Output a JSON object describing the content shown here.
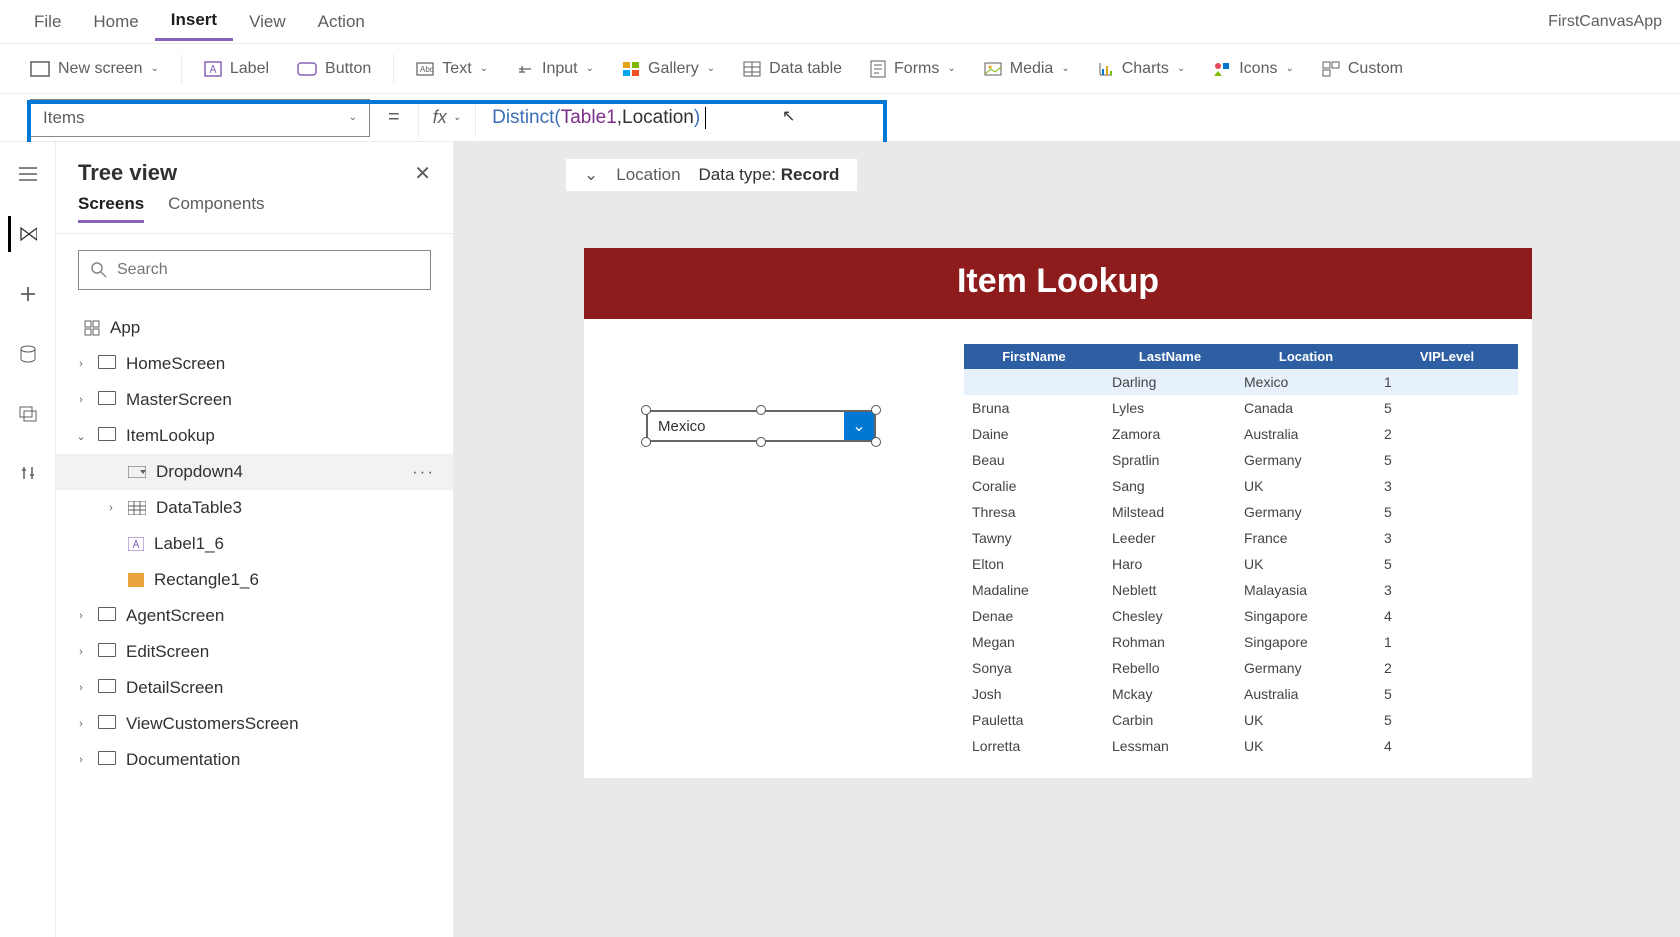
{
  "app_name": "FirstCanvasApp",
  "menu": [
    "File",
    "Home",
    "Insert",
    "View",
    "Action"
  ],
  "menu_active": "Insert",
  "ribbon": {
    "new_screen": "New screen",
    "label": "Label",
    "button": "Button",
    "text": "Text",
    "input": "Input",
    "gallery": "Gallery",
    "data_table": "Data table",
    "forms": "Forms",
    "media": "Media",
    "charts": "Charts",
    "icons": "Icons",
    "custom": "Custom"
  },
  "formula": {
    "property": "Items",
    "tokens": {
      "fn": "Distinct",
      "open": "(",
      "tbl": "Table1",
      "comma": ", ",
      "fld": "Location",
      "close": ")"
    }
  },
  "intelli": {
    "chev": "⌄",
    "field": "Location",
    "dt_label": "Data type:",
    "dt_value": "Record"
  },
  "tree": {
    "title": "Tree view",
    "tabs": [
      "Screens",
      "Components"
    ],
    "active_tab": "Screens",
    "search_placeholder": "Search",
    "app": "App",
    "nodes": [
      {
        "label": "HomeScreen",
        "depth": 0,
        "chev": "›",
        "icon": "screen"
      },
      {
        "label": "MasterScreen",
        "depth": 0,
        "chev": "›",
        "icon": "screen"
      },
      {
        "label": "ItemLookup",
        "depth": 0,
        "chev": "⌄",
        "icon": "screen"
      },
      {
        "label": "Dropdown4",
        "depth": 1,
        "chev": "",
        "icon": "dd",
        "selected": true,
        "more": "···"
      },
      {
        "label": "DataTable3",
        "depth": 1,
        "chev": "›",
        "icon": "table"
      },
      {
        "label": "Label1_6",
        "depth": 1,
        "chev": "",
        "icon": "label"
      },
      {
        "label": "Rectangle1_6",
        "depth": 1,
        "chev": "",
        "icon": "rect"
      },
      {
        "label": "AgentScreen",
        "depth": 0,
        "chev": "›",
        "icon": "screen"
      },
      {
        "label": "EditScreen",
        "depth": 0,
        "chev": "›",
        "icon": "screen"
      },
      {
        "label": "DetailScreen",
        "depth": 0,
        "chev": "›",
        "icon": "screen"
      },
      {
        "label": "ViewCustomersScreen",
        "depth": 0,
        "chev": "›",
        "icon": "screen"
      },
      {
        "label": "Documentation",
        "depth": 0,
        "chev": "›",
        "icon": "screen"
      }
    ]
  },
  "canvas": {
    "title": "Item Lookup",
    "dropdown_value": "Mexico",
    "table": {
      "headers": [
        "FirstName",
        "LastName",
        "Location",
        "VIPLevel"
      ],
      "rows": [
        [
          "",
          "Darling",
          "Mexico",
          "1"
        ],
        [
          "Bruna",
          "Lyles",
          "Canada",
          "5"
        ],
        [
          "Daine",
          "Zamora",
          "Australia",
          "2"
        ],
        [
          "Beau",
          "Spratlin",
          "Germany",
          "5"
        ],
        [
          "Coralie",
          "Sang",
          "UK",
          "3"
        ],
        [
          "Thresa",
          "Milstead",
          "Germany",
          "5"
        ],
        [
          "Tawny",
          "Leeder",
          "France",
          "3"
        ],
        [
          "Elton",
          "Haro",
          "UK",
          "5"
        ],
        [
          "Madaline",
          "Neblett",
          "Malayasia",
          "3"
        ],
        [
          "Denae",
          "Chesley",
          "Singapore",
          "4"
        ],
        [
          "Megan",
          "Rohman",
          "Singapore",
          "1"
        ],
        [
          "Sonya",
          "Rebello",
          "Germany",
          "2"
        ],
        [
          "Josh",
          "Mckay",
          "Australia",
          "5"
        ],
        [
          "Pauletta",
          "Carbin",
          "UK",
          "5"
        ],
        [
          "Lorretta",
          "Lessman",
          "UK",
          "4"
        ]
      ]
    }
  }
}
